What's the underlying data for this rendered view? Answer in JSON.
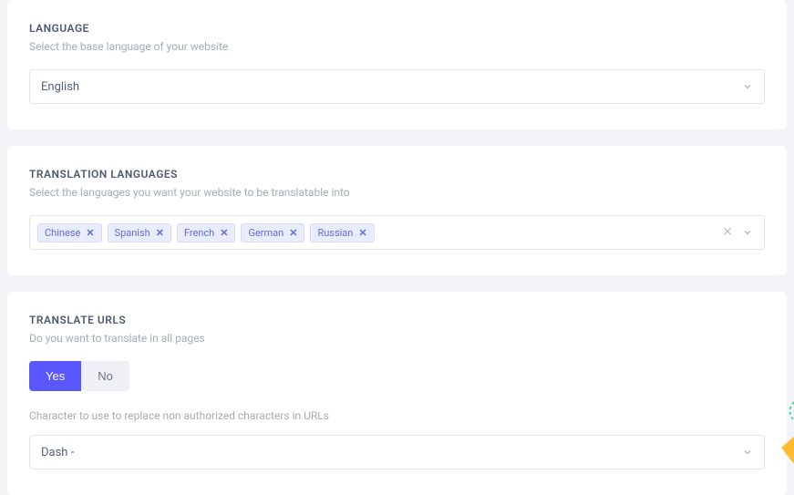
{
  "language": {
    "title": "LANGUAGE",
    "desc": "Select the base language of your website",
    "selected": "English"
  },
  "translation": {
    "title": "TRANSLATION LANGUAGES",
    "desc": "Select the languages you want your website to be translatable into",
    "tags": [
      "Chinese",
      "Spanish",
      "French",
      "German",
      "Russian"
    ]
  },
  "translateUrls": {
    "title": "TRANSLATE URLS",
    "desc": "Do you want to translate in all pages",
    "yes": "Yes",
    "no": "No",
    "subDesc": "Character to use to replace non authorized characters in URLs",
    "replaceChar": "Dash -"
  }
}
